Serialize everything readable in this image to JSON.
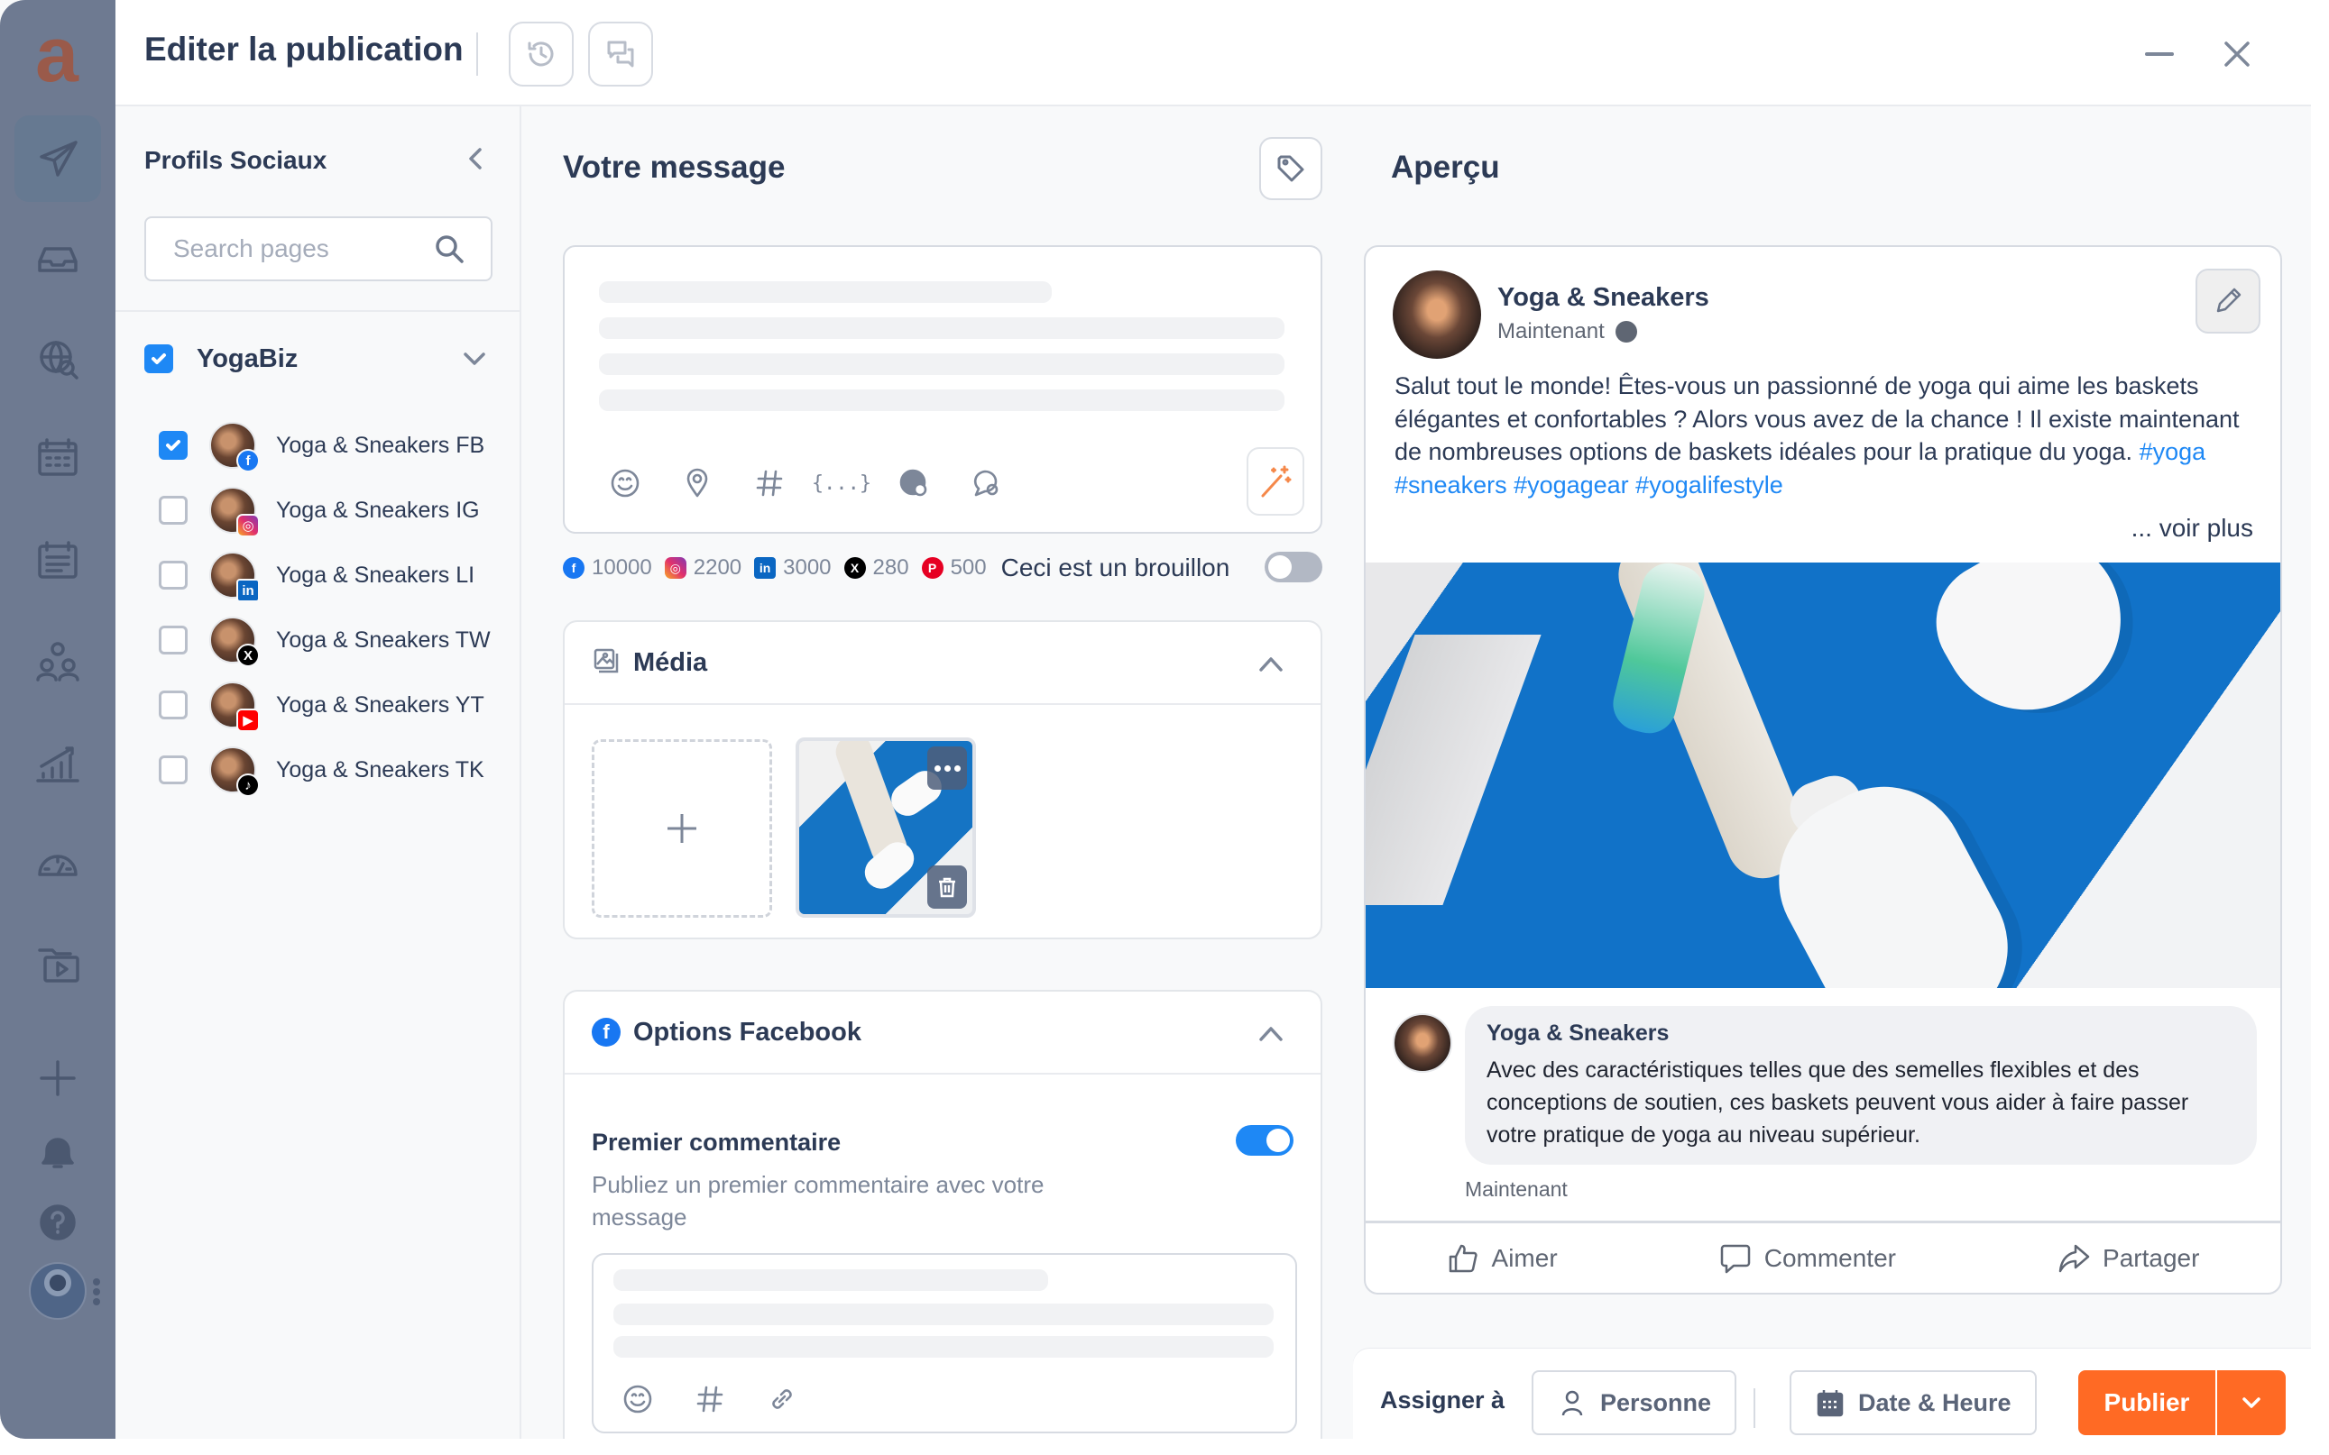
{
  "app": {
    "logo_letter": "a"
  },
  "sidebar": {
    "items": [
      {
        "name": "publish",
        "icon": "paper-plane-icon",
        "active": true
      },
      {
        "name": "inbox",
        "icon": "inbox-icon"
      },
      {
        "name": "social-listening",
        "icon": "globe-search-icon"
      },
      {
        "name": "calendar",
        "icon": "calendar-icon"
      },
      {
        "name": "content-planner",
        "icon": "calendar-list-icon"
      },
      {
        "name": "team",
        "icon": "users-icon"
      },
      {
        "name": "analytics",
        "icon": "bar-chart-icon"
      },
      {
        "name": "reports",
        "icon": "speedometer-icon"
      },
      {
        "name": "media-library",
        "icon": "media-folder-icon"
      },
      {
        "name": "add",
        "icon": "plus-icon"
      },
      {
        "name": "notifications",
        "icon": "bell-icon"
      },
      {
        "name": "help",
        "icon": "help-icon"
      }
    ]
  },
  "header": {
    "title": "Editer la publication",
    "history_icon": "history-icon",
    "comments_icon": "comments-icon",
    "minimize_icon": "minimize-icon",
    "close_icon": "close-icon"
  },
  "profiles": {
    "title": "Profils Sociaux",
    "search_placeholder": "Search pages",
    "search_value": "",
    "group": {
      "name": "YogaBiz",
      "checked": true
    },
    "items": [
      {
        "name": "Yoga & Sneakers FB",
        "network": "fb",
        "badge": "f",
        "checked": true
      },
      {
        "name": "Yoga & Sneakers IG",
        "network": "ig",
        "badge": "◎",
        "checked": false
      },
      {
        "name": "Yoga & Sneakers LI",
        "network": "li",
        "badge": "in",
        "checked": false
      },
      {
        "name": "Yoga & Sneakers TW",
        "network": "tw",
        "badge": "X",
        "checked": false
      },
      {
        "name": "Yoga & Sneakers YT",
        "network": "yt",
        "badge": "▶",
        "checked": false
      },
      {
        "name": "Yoga & Sneakers TK",
        "network": "tk",
        "badge": "♪",
        "checked": false
      }
    ]
  },
  "message": {
    "title": "Votre message",
    "tools": [
      "emoji-icon",
      "location-icon",
      "hashtag-icon",
      "variables-icon",
      "language-icon",
      "comment-icon"
    ],
    "variables_label": "{...}",
    "char_limits": [
      {
        "network": "fb",
        "glyph": "f",
        "value": "10000"
      },
      {
        "network": "ig",
        "glyph": "◎",
        "value": "2200"
      },
      {
        "network": "li",
        "glyph": "in",
        "value": "3000"
      },
      {
        "network": "tw",
        "glyph": "X",
        "value": "280"
      },
      {
        "network": "pi",
        "glyph": "P",
        "value": "500"
      }
    ],
    "draft_label": "Ceci est un brouillon",
    "draft_on": false
  },
  "media": {
    "title": "Média",
    "items_count": 1
  },
  "facebook_options": {
    "title": "Options Facebook",
    "first_comment_title": "Premier commentaire",
    "first_comment_desc": "Publiez un premier commentaire avec votre message",
    "first_comment_enabled": true
  },
  "preview": {
    "title": "Aperçu",
    "page_name": "Yoga & Sneakers",
    "time": "Maintenant",
    "text": "Salut tout le monde! Êtes-vous un passionné de yoga qui aime les baskets élégantes et confortables ? Alors vous avez de la chance ! Il existe maintenant de nombreuses options de baskets idéales pour la pratique du yoga.",
    "hashtags": "#yoga #sneakers #yogagear #yogalifestyle",
    "see_more": "... voir plus",
    "comment": {
      "author": "Yoga & Sneakers",
      "text": "Avec des caractéristiques telles que des semelles flexibles et des conceptions de soutien, ces baskets peuvent vous aider à faire passer votre pratique de yoga au niveau supérieur.",
      "time": "Maintenant"
    },
    "actions": {
      "like": "Aimer",
      "comment": "Commenter",
      "share": "Partager"
    }
  },
  "footer": {
    "assign_label": "Assigner à",
    "person_label": "Personne",
    "date_label": "Date & Heure",
    "publish_label": "Publier"
  },
  "colors": {
    "accent": "#1e88f5",
    "publish": "#ff6a24",
    "sidebar": "#6e7a91",
    "text": "#2c3a55"
  }
}
